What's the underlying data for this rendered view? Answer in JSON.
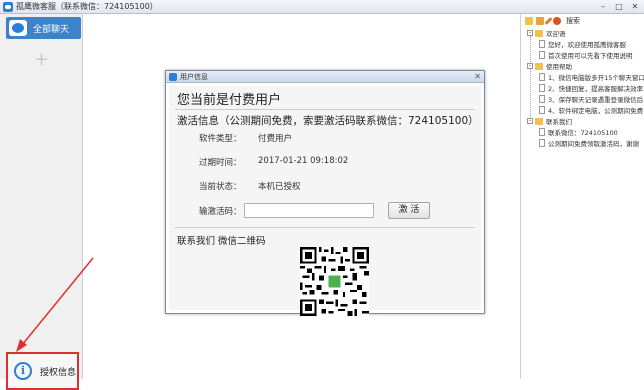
{
  "window": {
    "title": "孤鹰微客服（联系微信：724105100）",
    "controls": {
      "minimize": "–",
      "maximize": "□",
      "close": "✕"
    }
  },
  "sidebar": {
    "conversation_label": "全部聊天",
    "add_label": "+",
    "auth_label": "授权信息",
    "auth_icon": "i"
  },
  "dialog": {
    "title": "用户信息",
    "close_glyph": "✕",
    "heading": "您当前是付费用户",
    "activation_info": "激活信息（公测期间免费，索要激活码联系微信：724105100）",
    "rows": [
      {
        "label": "软件类型：",
        "value": "付费用户"
      },
      {
        "label": "过期时间：",
        "value": "2017-01-21 09:18:02"
      },
      {
        "label": "当前状态：",
        "value": "本机已授权"
      }
    ],
    "input_label": "输激活码：",
    "input_value": "",
    "activate_button": "激 活",
    "contact_label": "联系我们 微信二维码"
  },
  "right_panel": {
    "toolbar": {
      "icons": [
        "folder-add-icon",
        "copy-icon",
        "edit-icon",
        "delete-icon"
      ],
      "search_label": "搜索"
    },
    "tree": [
      {
        "category": "欢迎语",
        "items": [
          "您好，欢迎使用孤鹰微客服",
          "首次使用可以先看下使用说明"
        ]
      },
      {
        "category": "使用帮助",
        "items": [
          "1、微信电脑版多开15个聊天窗口",
          "2、快捷回复，提高客服解决效率",
          "3、保存聊天记录遇重登录微信后",
          "4、软件绑定电脑，公测期间免费"
        ]
      },
      {
        "category": "联系我们",
        "items": [
          "联系微信：724105100",
          "公测期间免费领取激活码，谢谢"
        ]
      }
    ]
  },
  "colors": {
    "accent": "#3d83c9",
    "highlight_border": "#d93030",
    "folder": "#f0c050"
  }
}
